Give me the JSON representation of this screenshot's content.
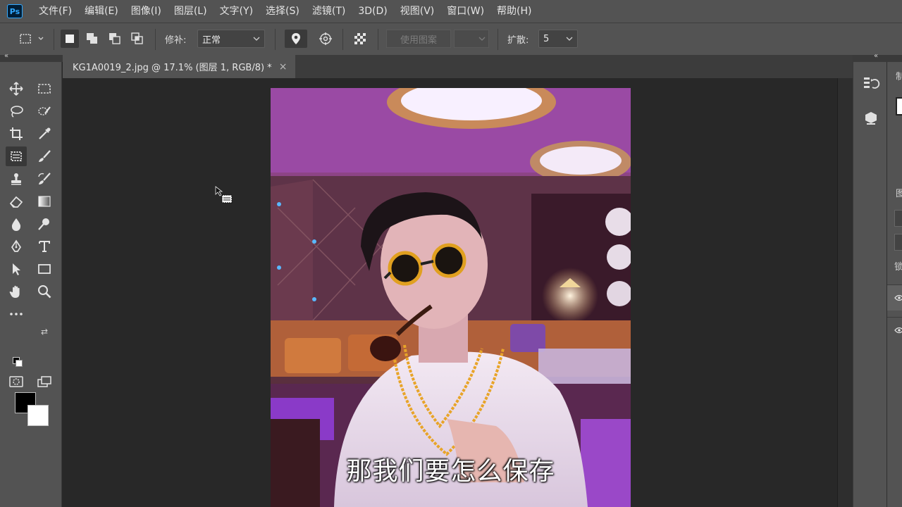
{
  "app": {
    "logo": "Ps"
  },
  "menu": [
    "文件(F)",
    "编辑(E)",
    "图像(I)",
    "图层(L)",
    "文字(Y)",
    "选择(S)",
    "滤镜(T)",
    "3D(D)",
    "视图(V)",
    "窗口(W)",
    "帮助(H)"
  ],
  "options": {
    "patch_label": "修补:",
    "patch_mode": "正常",
    "use_pattern": "使用图案",
    "diffusion_label": "扩散:",
    "diffusion_value": "5"
  },
  "document": {
    "tab_title": "KG1A0019_2.jpg @ 17.1% (图层 1, RGB/8) *",
    "close_glyph": "×"
  },
  "subtitle": "那我们要怎么保存",
  "tools": [
    "move-tool",
    "marquee-tool",
    "lasso-tool",
    "quick-selection-tool",
    "crop-tool",
    "eyedropper-tool",
    "patch-tool",
    "brush-tool",
    "clone-stamp-tool",
    "history-brush-tool",
    "eraser-tool",
    "gradient-tool",
    "blur-tool",
    "dodge-tool",
    "pen-tool",
    "type-tool",
    "path-selection-tool",
    "rectangle-tool",
    "hand-tool",
    "zoom-tool",
    "more-tools"
  ],
  "colors": {
    "foreground": "#000000",
    "background": "#ffffff",
    "accent": "#31a8ff"
  },
  "right_panel": {
    "labels": [
      "制",
      "图",
      "锁"
    ]
  }
}
